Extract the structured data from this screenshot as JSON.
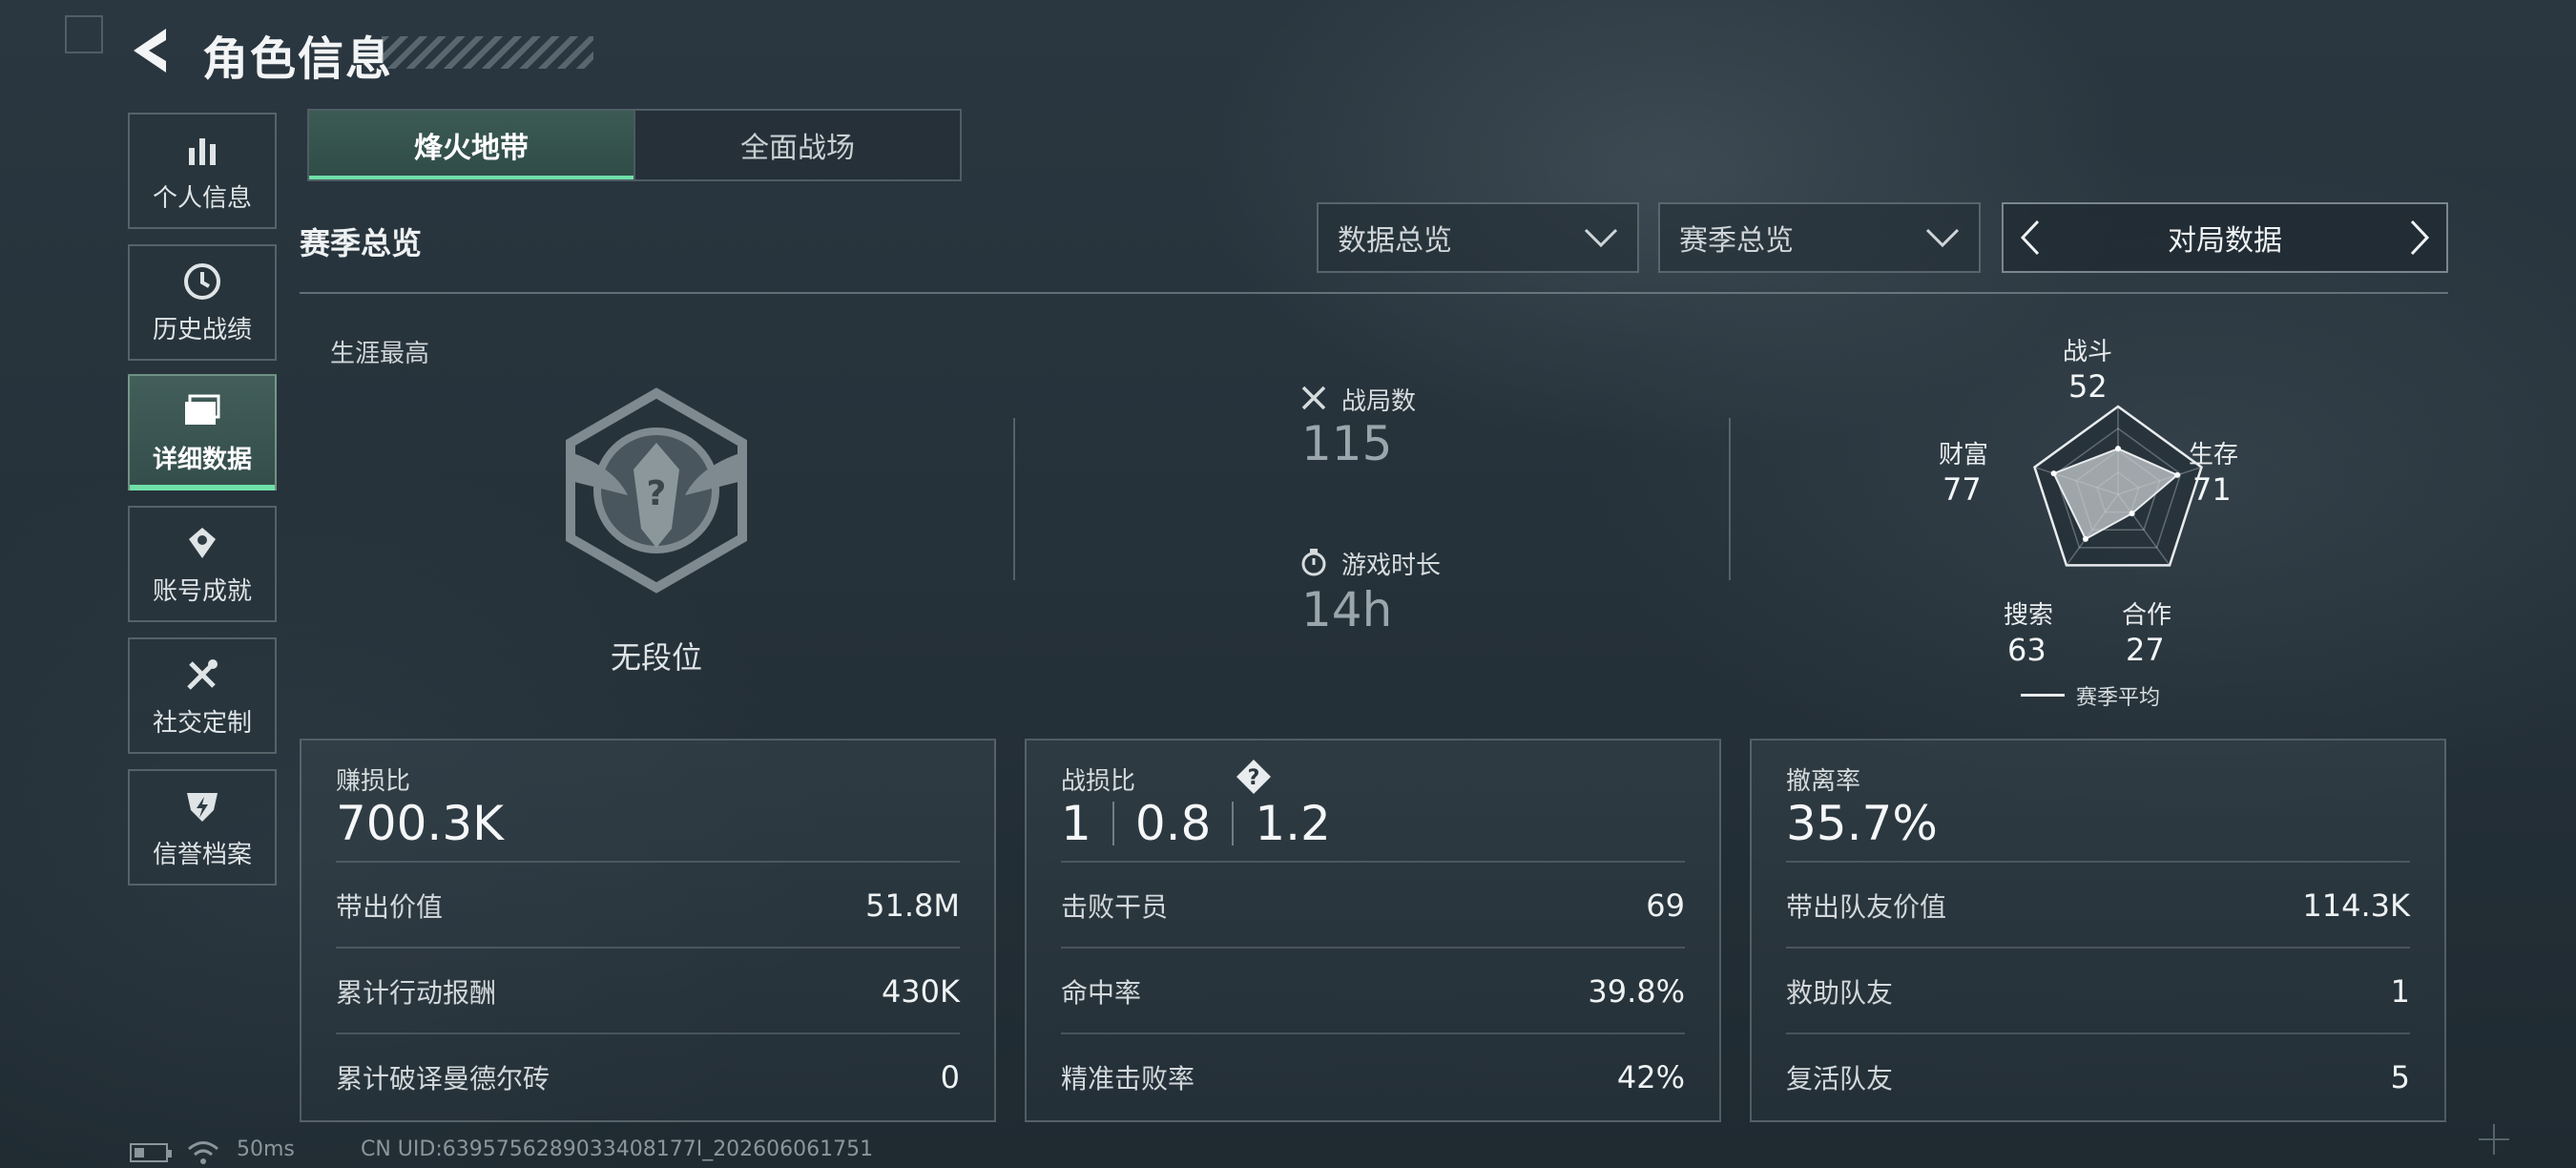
{
  "header": {
    "title": "角色信息"
  },
  "sidebar": {
    "items": [
      {
        "label": "个人信息",
        "icon": "bar-chart-icon"
      },
      {
        "label": "历史战绩",
        "icon": "history-clock-icon"
      },
      {
        "label": "详细数据",
        "icon": "folder-icon",
        "active": true
      },
      {
        "label": "账号成就",
        "icon": "achievement-badge-icon"
      },
      {
        "label": "社交定制",
        "icon": "tools-icon"
      },
      {
        "label": "信誉档案",
        "icon": "shield-lightning-icon"
      }
    ]
  },
  "mode_tabs": [
    {
      "label": "烽火地带",
      "active": true
    },
    {
      "label": "全面战场",
      "active": false
    }
  ],
  "section_title": "赛季总览",
  "filters": {
    "data_select": "数据总览",
    "season_select": "赛季总览",
    "pager_label": "对局数据"
  },
  "overview": {
    "career_label": "生涯最高",
    "rank_text": "无段位",
    "matches_label": "战局数",
    "matches_value": "115",
    "playtime_label": "游戏时长",
    "playtime_value": "14h"
  },
  "radar": {
    "axes": [
      {
        "name": "战斗",
        "value": 52
      },
      {
        "name": "生存",
        "value": 71
      },
      {
        "name": "合作",
        "value": 27
      },
      {
        "name": "搜索",
        "value": 63
      },
      {
        "name": "财富",
        "value": 77
      }
    ],
    "legend": "赛季平均",
    "max": 100
  },
  "cards": {
    "profit": {
      "title": "赚损比",
      "main": "700.3K",
      "rows": [
        {
          "label": "带出价值",
          "value": "51.8M"
        },
        {
          "label": "累计行动报酬",
          "value": "430K"
        },
        {
          "label": "累计破译曼德尔砖",
          "value": "0"
        }
      ]
    },
    "combat": {
      "title": "战损比",
      "kd": [
        "1",
        "0.8",
        "1.2"
      ],
      "rows": [
        {
          "label": "击败干员",
          "value": "69"
        },
        {
          "label": "命中率",
          "value": "39.8%"
        },
        {
          "label": "精准击败率",
          "value": "42%"
        }
      ]
    },
    "extract": {
      "title": "撤离率",
      "main": "35.7%",
      "rows": [
        {
          "label": "带出队友价值",
          "value": "114.3K"
        },
        {
          "label": "救助队友",
          "value": "1"
        },
        {
          "label": "复活队友",
          "value": "5"
        }
      ]
    }
  },
  "footer": {
    "ping": "50ms",
    "uid": "CN UID:6395756289033408177I_202606061751"
  },
  "colors": {
    "accent": "#6fe0a8"
  }
}
